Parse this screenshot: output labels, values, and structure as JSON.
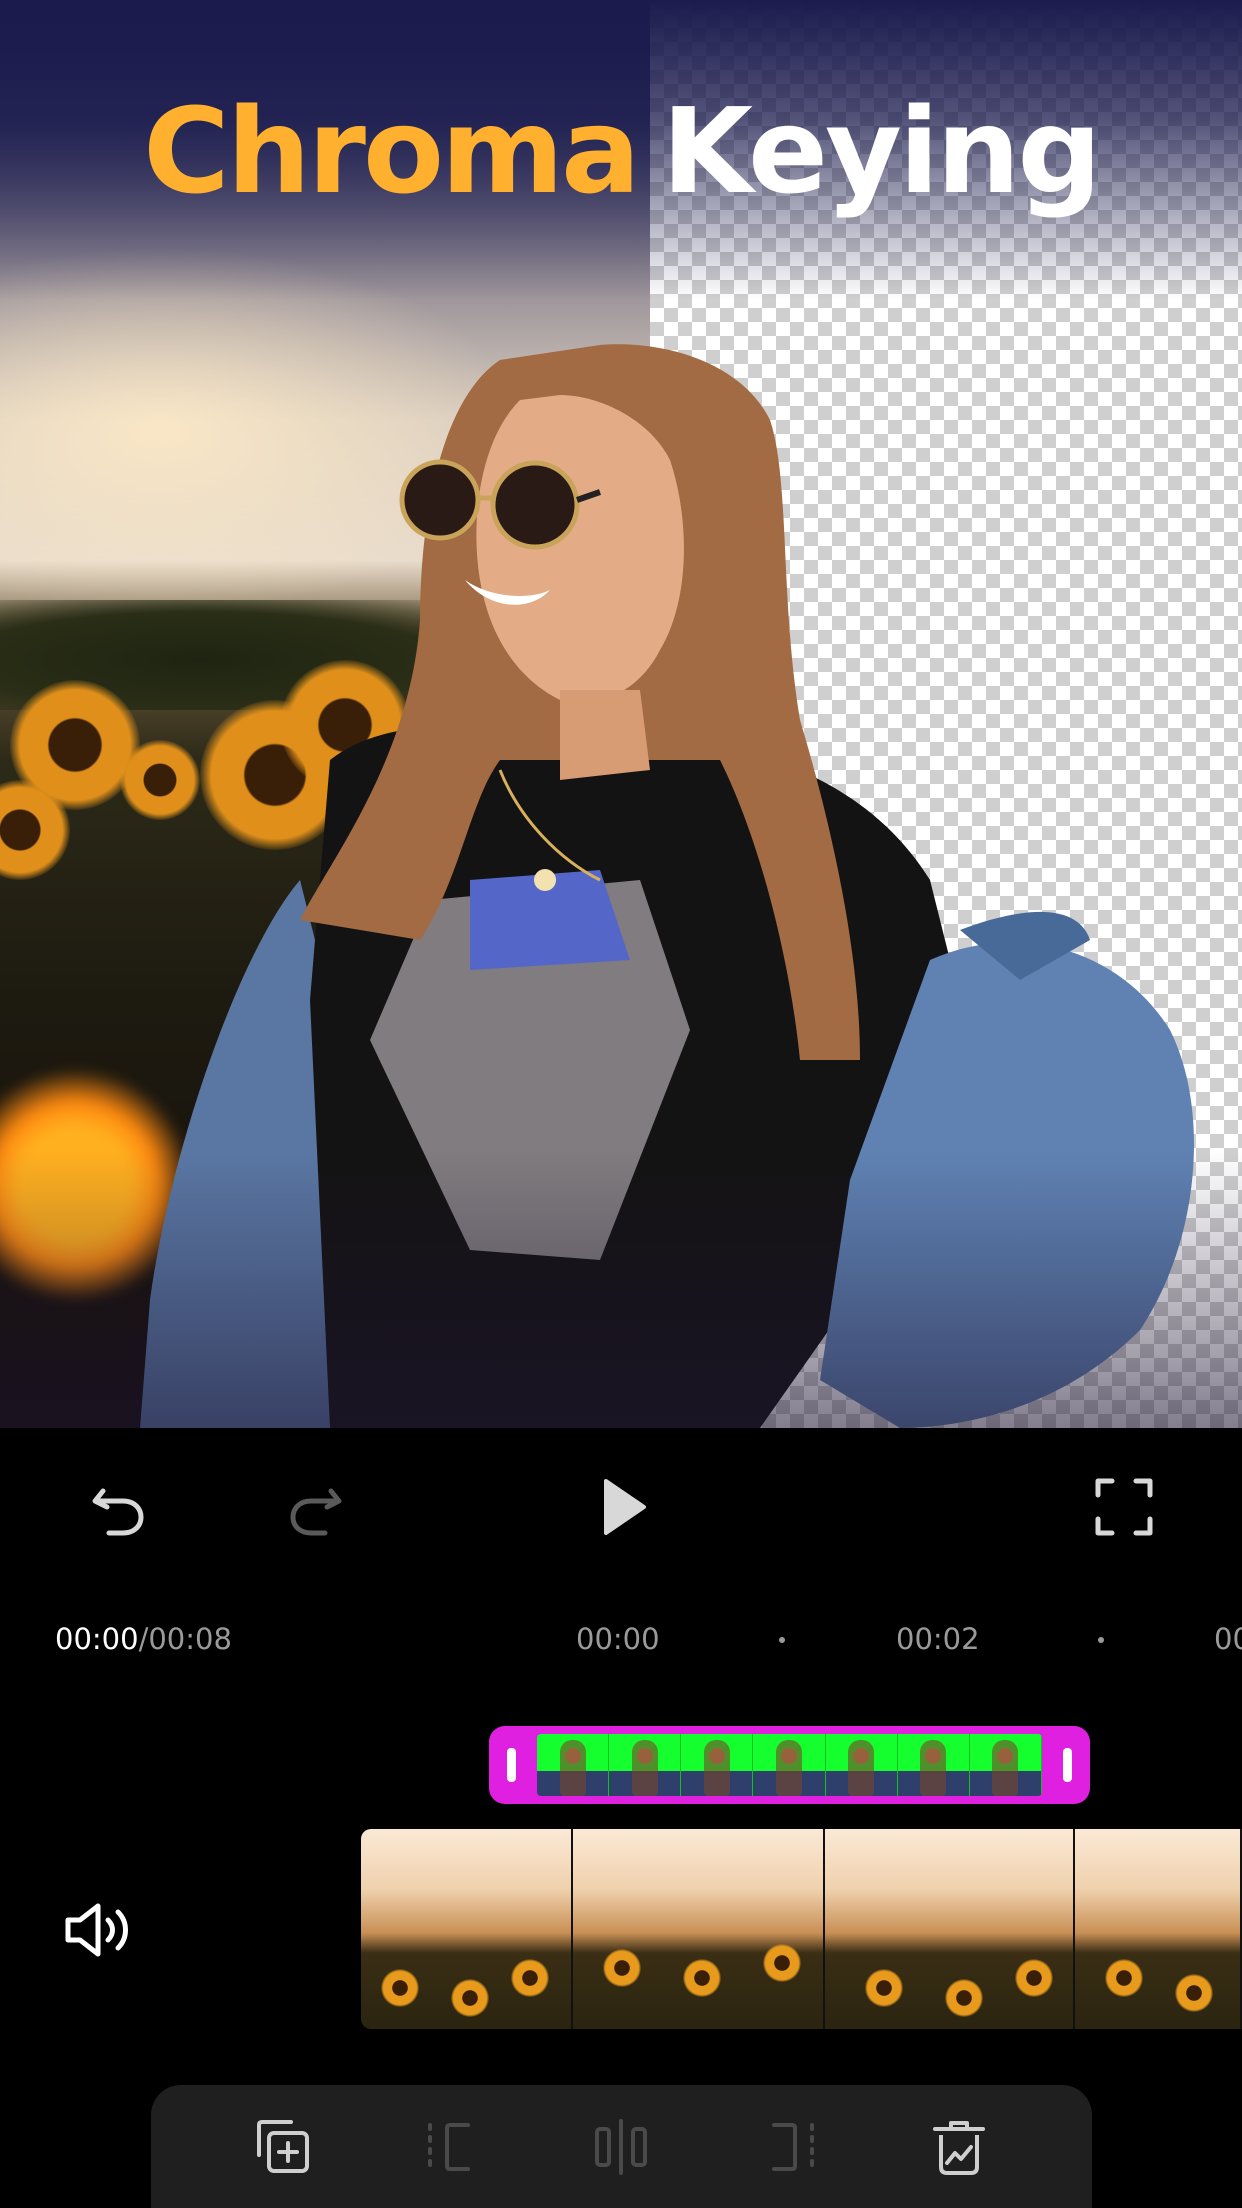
{
  "headline": {
    "word1": "Chroma",
    "word2": "Keying"
  },
  "playback": {
    "current_time": "00:00",
    "separator": "/",
    "total_time": "00:08",
    "ruler_labels": [
      "00:00",
      "00:02",
      "00"
    ]
  },
  "icons": {
    "undo": "undo-icon",
    "redo": "redo-icon",
    "play": "play-icon",
    "fullscreen": "fullscreen-icon",
    "volume": "volume-icon",
    "toolbar": [
      "add-clip-icon",
      "trim-start-icon",
      "split-icon",
      "trim-end-icon",
      "delete-icon"
    ]
  },
  "colors": {
    "headline_accent": "#ffb02e",
    "overlay_clip": "#e020e0",
    "green_screen": "#15ff2e",
    "toolbar_bg": "#1f1f1f"
  },
  "states": {
    "redo_enabled": false,
    "toolbar_enabled": [
      true,
      false,
      false,
      false,
      true
    ]
  }
}
